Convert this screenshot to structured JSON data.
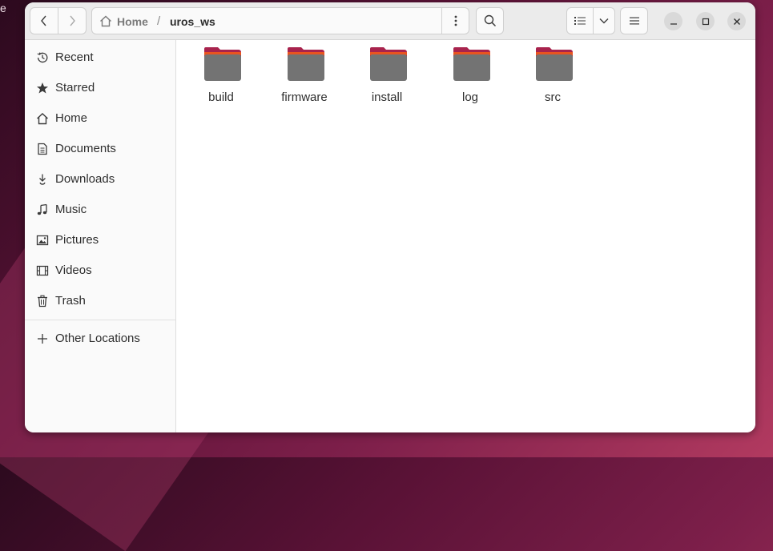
{
  "wallpaper": {
    "edge_text": "e"
  },
  "navigation": {
    "back_icon": "chevron-left-icon",
    "forward_icon": "chevron-right-icon"
  },
  "pathbar": {
    "home_label": "Home",
    "separator": "/",
    "current_folder": "uros_ws"
  },
  "toolbar": {
    "path_menu_icon": "vertical-ellipsis-icon",
    "search_icon": "search-icon",
    "view_icon": "list-view-icon",
    "view_options_icon": "chevron-down-icon",
    "main_menu_icon": "hamburger-menu-icon"
  },
  "window_controls": {
    "minimize": "minimize-icon",
    "maximize": "maximize-icon",
    "close": "close-icon"
  },
  "sidebar": {
    "items": [
      {
        "label": "Recent",
        "icon": "clock-icon"
      },
      {
        "label": "Starred",
        "icon": "star-icon"
      },
      {
        "label": "Home",
        "icon": "home-icon"
      },
      {
        "label": "Documents",
        "icon": "document-icon"
      },
      {
        "label": "Downloads",
        "icon": "download-icon"
      },
      {
        "label": "Music",
        "icon": "music-note-icon"
      },
      {
        "label": "Pictures",
        "icon": "picture-icon"
      },
      {
        "label": "Videos",
        "icon": "film-icon"
      },
      {
        "label": "Trash",
        "icon": "trash-icon"
      }
    ],
    "other_locations": {
      "label": "Other Locations",
      "icon": "plus-icon"
    }
  },
  "content": {
    "folders": [
      {
        "name": "build"
      },
      {
        "name": "firmware"
      },
      {
        "name": "install"
      },
      {
        "name": "log"
      },
      {
        "name": "src"
      }
    ]
  },
  "colors": {
    "folder_body": "#737373",
    "folder_tab": "#a8234d",
    "folder_accent": "#e95420",
    "headerbar": "#ebebeb",
    "sidebar": "#fafafa"
  }
}
